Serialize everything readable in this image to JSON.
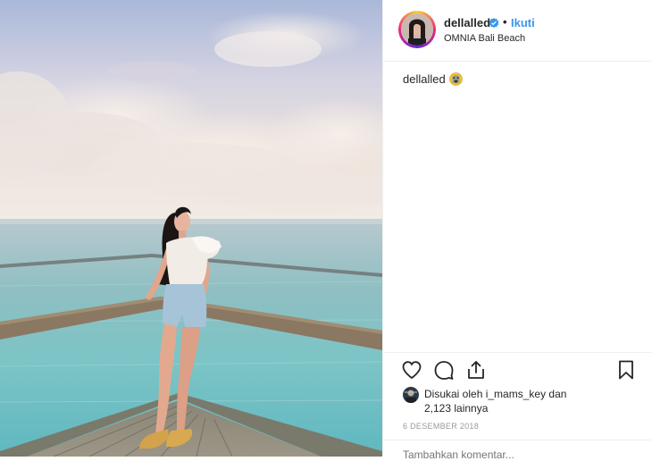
{
  "post": {
    "username": "dellalled",
    "follow_label": "Ikuti",
    "separator": "•",
    "location": "OMNIA Bali Beach",
    "caption_user": "dellalled",
    "caption_emoji": "emoji-face-icon",
    "liked_by_prefix": "Disukai oleh",
    "liked_by_user": "i_mams_key",
    "liked_by_suffix": "dan",
    "others_count": "2,123 lainnya",
    "date": "6 DESEMBER 2018",
    "comment_placeholder": "Tambahkan komentar..."
  },
  "icons": {
    "verified": "verified-badge-icon",
    "like": "heart-icon",
    "comment": "comment-bubble-icon",
    "share": "share-icon",
    "save": "bookmark-icon"
  },
  "colors": {
    "follow_blue": "#3897f0",
    "verified_blue": "#3897f0",
    "text": "#262626",
    "muted": "#999999"
  }
}
